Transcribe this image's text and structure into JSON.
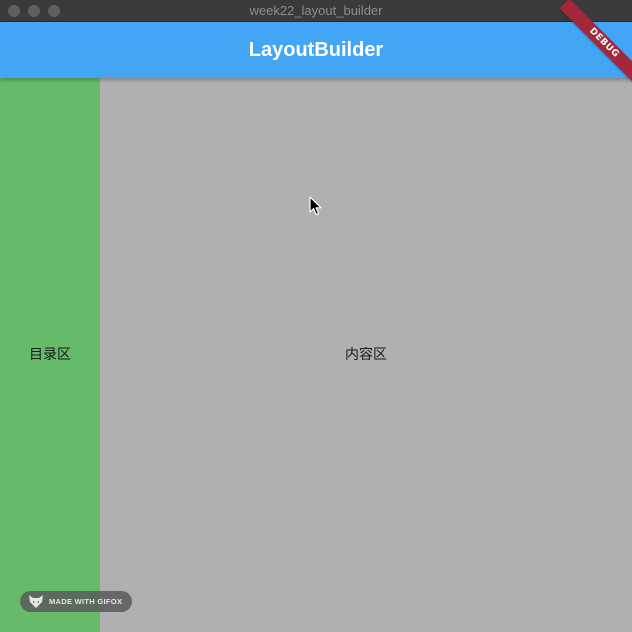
{
  "window": {
    "title": "week22_layout_builder"
  },
  "appbar": {
    "title": "LayoutBuilder",
    "color": "#42a5f5"
  },
  "debug_banner": {
    "label": "DEBUG"
  },
  "sidebar": {
    "label": "目录区",
    "color": "#66bb6a"
  },
  "main": {
    "label": "内容区",
    "color": "#b0b0b0"
  },
  "watermark": {
    "text": "MADE WITH GIFOX",
    "icon": "fox-icon"
  }
}
